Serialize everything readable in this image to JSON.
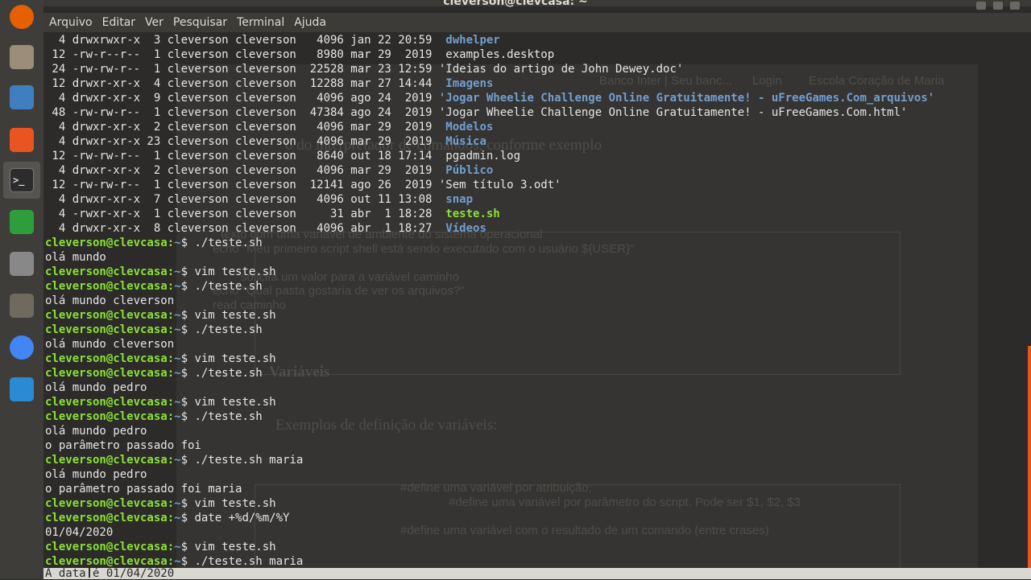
{
  "window": {
    "title": "cleverson@clevcasa: ~"
  },
  "menu": [
    "Arquivo",
    "Editar",
    "Ver",
    "Pesquisar",
    "Terminal",
    "Ajuda"
  ],
  "dock": [
    {
      "name": "firefox-icon",
      "color": "#e66000"
    },
    {
      "name": "files-icon",
      "color": "#9b8d7a"
    },
    {
      "name": "document-viewer-icon",
      "color": "#3f7fbf"
    },
    {
      "name": "software-store-icon",
      "color": "#e95420"
    },
    {
      "name": "terminal-icon",
      "color": "#2c2c2c"
    },
    {
      "name": "spreadsheet-icon",
      "color": "#2e9e3d"
    },
    {
      "name": "settings-icon",
      "color": "#888888"
    },
    {
      "name": "gimp-icon",
      "color": "#6e6a5e"
    },
    {
      "name": "chrome-icon",
      "color": "#4285f4"
    },
    {
      "name": "vscode-icon",
      "color": "#2a8ad4"
    }
  ],
  "listing": [
    {
      "pre": "  4 drwxrwxr-x  3 cleverson cleverson   4096 jan 22 20:59  ",
      "name": "dwhelper",
      "kind": "dir"
    },
    {
      "pre": " 12 -rw-r--r--  1 cleverson cleverson   8980 mar 29  2019  ",
      "name": "examples.desktop",
      "kind": "file"
    },
    {
      "pre": " 24 -rw-rw-r--  1 cleverson cleverson  22528 mar 23 12:59 ",
      "name": "'Ideias do artigo de John Dewey.doc'",
      "kind": "file"
    },
    {
      "pre": " 12 drwxr-xr-x  4 cleverson cleverson  12288 mar 27 14:44  ",
      "name": "Imagens",
      "kind": "dir"
    },
    {
      "pre": "  4 drwxr-xr-x  9 cleverson cleverson   4096 ago 24  2019 ",
      "name": "'Jogar Wheelie Challenge Online Gratuitamente! - uFreeGames.Com_arquivos'",
      "kind": "dir"
    },
    {
      "pre": " 48 -rw-rw-r--  1 cleverson cleverson  47384 ago 24  2019 ",
      "name": "'Jogar Wheelie Challenge Online Gratuitamente! - uFreeGames.Com.html'",
      "kind": "file"
    },
    {
      "pre": "  4 drwxr-xr-x  2 cleverson cleverson   4096 mar 29  2019  ",
      "name": "Modelos",
      "kind": "dir"
    },
    {
      "pre": "  4 drwxr-xr-x 23 cleverson cleverson   4096 mar 29  2019  ",
      "name": "Música",
      "kind": "dir"
    },
    {
      "pre": " 12 -rw-rw-r--  1 cleverson cleverson   8640 out 18 17:14  ",
      "name": "pgadmin.log",
      "kind": "file"
    },
    {
      "pre": "  4 drwxr-xr-x  2 cleverson cleverson   4096 mar 29  2019  ",
      "name": "Público",
      "kind": "dir"
    },
    {
      "pre": " 12 -rw-rw-r--  1 cleverson cleverson  12141 ago 26  2019 ",
      "name": "'Sem título 3.odt'",
      "kind": "file"
    },
    {
      "pre": "  4 drwxr-xr-x  7 cleverson cleverson   4096 out 11 13:08  ",
      "name": "snap",
      "kind": "dir"
    },
    {
      "pre": "  4 -rwxr-xr-x  1 cleverson cleverson     31 abr  1 18:28  ",
      "name": "teste.sh",
      "kind": "exec"
    },
    {
      "pre": "  4 drwxr-xr-x  8 cleverson cleverson   4096 abr  1 18:27  ",
      "name": "Vídeos",
      "kind": "dir"
    }
  ],
  "session": [
    {
      "prompt": "cleverson@clevcasa",
      "path": "~",
      "cmd": "./teste.sh"
    },
    {
      "out": "olá mundo"
    },
    {
      "prompt": "cleverson@clevcasa",
      "path": "~",
      "cmd": "vim teste.sh"
    },
    {
      "prompt": "cleverson@clevcasa",
      "path": "~",
      "cmd": "./teste.sh"
    },
    {
      "out": "olá mundo cleverson"
    },
    {
      "prompt": "cleverson@clevcasa",
      "path": "~",
      "cmd": "vim teste.sh"
    },
    {
      "prompt": "cleverson@clevcasa",
      "path": "~",
      "cmd": "./teste.sh"
    },
    {
      "out": "olá mundo cleverson"
    },
    {
      "prompt": "cleverson@clevcasa",
      "path": "~",
      "cmd": "vim teste.sh"
    },
    {
      "prompt": "cleverson@clevcasa",
      "path": "~",
      "cmd": "./teste.sh"
    },
    {
      "out": "olá mundo pedro"
    },
    {
      "prompt": "cleverson@clevcasa",
      "path": "~",
      "cmd": "vim teste.sh"
    },
    {
      "prompt": "cleverson@clevcasa",
      "path": "~",
      "cmd": "./teste.sh"
    },
    {
      "out": "olá mundo pedro"
    },
    {
      "out": "o parâmetro passado foi"
    },
    {
      "prompt": "cleverson@clevcasa",
      "path": "~",
      "cmd": "./teste.sh maria"
    },
    {
      "out": "olá mundo pedro"
    },
    {
      "out": "o parâmetro passado foi maria"
    },
    {
      "prompt": "cleverson@clevcasa",
      "path": "~",
      "cmd": "vim teste.sh"
    },
    {
      "prompt": "cleverson@clevcasa",
      "path": "~",
      "cmd": "date +%d/%m/%Y"
    },
    {
      "out": "01/04/2020"
    },
    {
      "prompt": "cleverson@clevcasa",
      "path": "~",
      "cmd": "vim teste.sh"
    },
    {
      "prompt": "cleverson@clevcasa",
      "path": "~",
      "cmd": "./teste.sh maria"
    }
  ],
  "status_line": "A data é 01/04/2020",
  "background_doc": {
    "bookmarks": [
      "Banco Inter | Seu banc...",
      "Login",
      "Escola Coração de Maria"
    ],
    "heading_fragment": "o    do  interpretador  de  comandos,  conforme  exemplo",
    "code1": [
      "echo \"Meu primeiro script shell está sendo executado com o usuário ${USER}\"",
      "echo \"Qual pasta gostaria de ver os arquivos?\"",
      "read caminho"
    ],
    "comments1": [
      "texto com uma variável de ambiente do sistema operacional",
      "solicita um valor para a variável caminho"
    ],
    "section": "Variáveis",
    "example_title": "Exemplos de definição de variáveis:",
    "defs": [
      "#define uma variável por atribuição;",
      "#define uma variável por parâmetro do script. Pode ser $1, $2, $3",
      "#define uma variável com o resultado de um comando (entre crases)"
    ]
  }
}
